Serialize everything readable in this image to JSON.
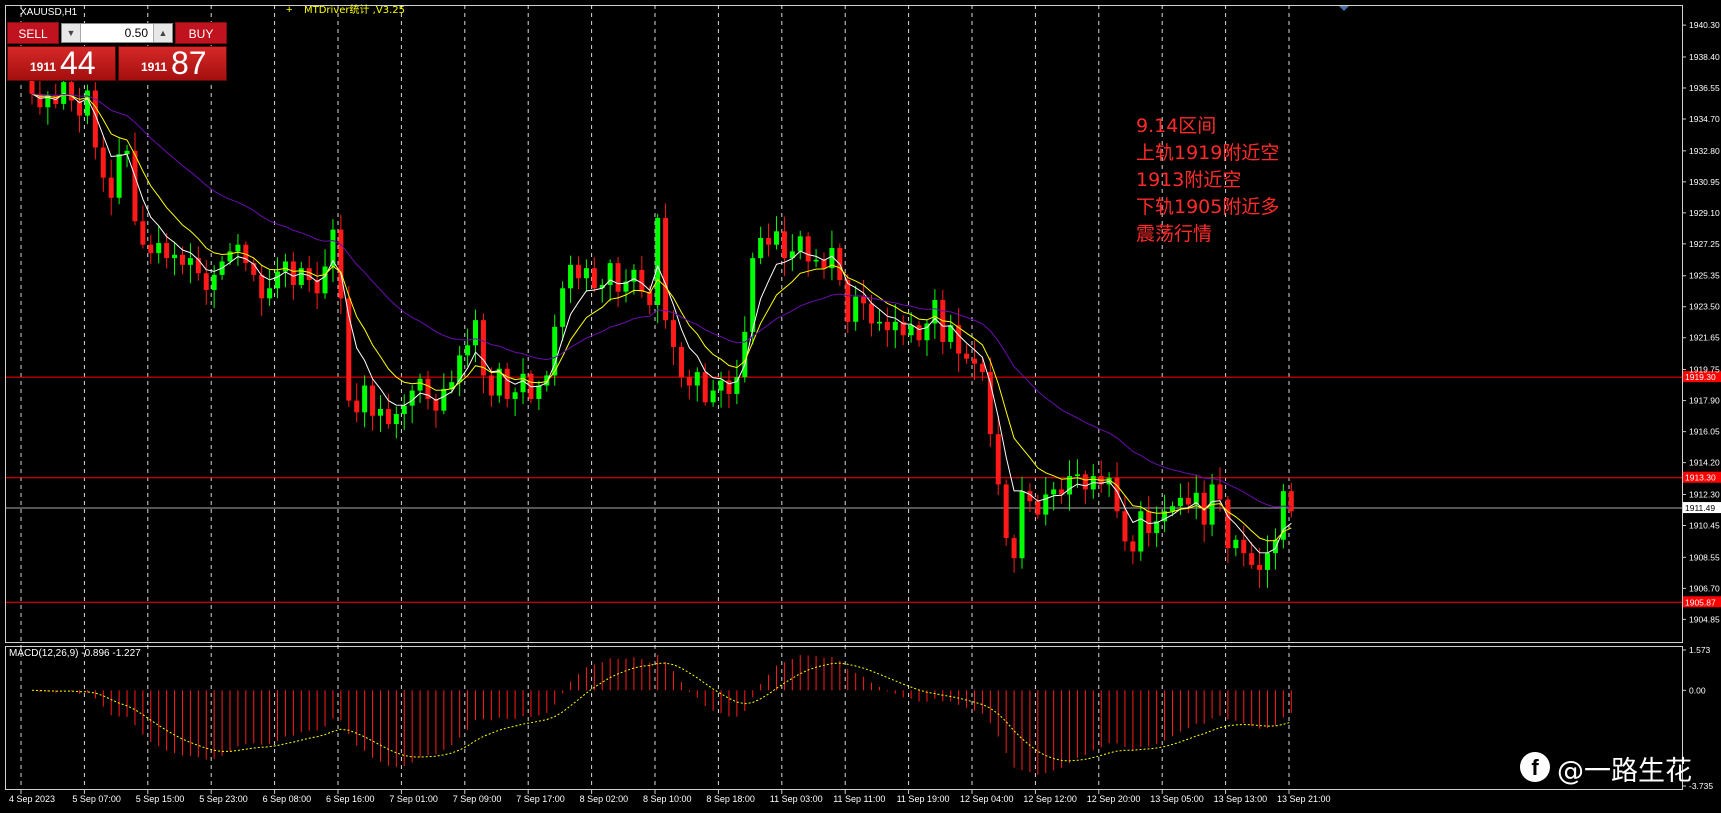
{
  "window": {
    "symbol_label": "XAUUSD,H1",
    "indicator_label": "MTDriver统计 ,V3.25",
    "indicator_plus": "+"
  },
  "trade_panel": {
    "sell_label": "SELL",
    "buy_label": "BUY",
    "lot_value": "0.50",
    "sell_price_small": "1911",
    "sell_price_big": "44",
    "buy_price_small": "1911",
    "buy_price_big": "87"
  },
  "annotation": {
    "lines": [
      "9.14区间",
      "上轨1919附近空",
      "1913附近空",
      "下轨1905附近多",
      "震荡行情"
    ],
    "color": "#ff2a2a"
  },
  "watermark": {
    "icon": "facebook-icon",
    "text": "@一路生花"
  },
  "colors": {
    "bull": "#00ff00",
    "bear": "#ff1a1a",
    "ma_fast": "#ffffff",
    "ma_mid": "#ffff00",
    "ma_slow": "#6a0dad",
    "level": "#ff0000",
    "grid": "#ffffff"
  },
  "chart_data": [
    {
      "type": "candlestick",
      "title": "XAUUSD,H1",
      "ylim": [
        1903.5,
        1941.5
      ],
      "y_ticks": [
        "1940.30",
        "1938.40",
        "1936.55",
        "1934.70",
        "1932.80",
        "1930.95",
        "1929.10",
        "1927.25",
        "1925.35",
        "1923.50",
        "1921.65",
        "1919.75",
        "1917.90",
        "1916.05",
        "1914.20",
        "1912.30",
        "1910.45",
        "1908.55",
        "1906.70",
        "1904.85"
      ],
      "x_labels": [
        "4 Sep 2023",
        "5 Sep 07:00",
        "5 Sep 15:00",
        "5 Sep 23:00",
        "6 Sep 08:00",
        "6 Sep 16:00",
        "7 Sep 01:00",
        "7 Sep 09:00",
        "7 Sep 17:00",
        "8 Sep 02:00",
        "8 Sep 10:00",
        "8 Sep 18:00",
        "11 Sep 03:00",
        "11 Sep 11:00",
        "11 Sep 19:00",
        "12 Sep 04:00",
        "12 Sep 12:00",
        "12 Sep 20:00",
        "13 Sep 05:00",
        "13 Sep 13:00",
        "13 Sep 21:00"
      ],
      "levels": [
        {
          "value": 1919.3,
          "label": "1919.30"
        },
        {
          "value": 1913.3,
          "label": "1913.30"
        },
        {
          "value": 1905.87,
          "label": "1905.87"
        }
      ],
      "current_price": {
        "value": 1911.49,
        "label": "1911.49"
      },
      "closes": [
        1936.2,
        1935.4,
        1936.1,
        1935.6,
        1936.9,
        1935.8,
        1934.9,
        1936.4,
        1933.0,
        1931.2,
        1930.0,
        1932.6,
        1932.8,
        1928.6,
        1927.2,
        1926.7,
        1927.3,
        1926.4,
        1926.6,
        1926.0,
        1926.4,
        1925.5,
        1924.5,
        1925.4,
        1926.2,
        1926.8,
        1927.2,
        1926.1,
        1925.4,
        1924.0,
        1924.6,
        1925.6,
        1926.2,
        1924.8,
        1925.8,
        1925.1,
        1924.3,
        1925.9,
        1928.1,
        1924.0,
        1917.9,
        1917.2,
        1918.8,
        1917.0,
        1917.4,
        1916.5,
        1917.1,
        1917.6,
        1918.5,
        1919.2,
        1918.0,
        1917.3,
        1918.6,
        1919.0,
        1920.6,
        1921.2,
        1922.7,
        1919.4,
        1918.2,
        1919.8,
        1918.0,
        1918.4,
        1919.5,
        1918.0,
        1918.8,
        1919.4,
        1922.3,
        1924.6,
        1926.0,
        1925.2,
        1925.8,
        1924.6,
        1924.8,
        1926.1,
        1924.4,
        1925.0,
        1925.7,
        1924.4,
        1923.6,
        1928.8,
        1922.7,
        1921.1,
        1919.3,
        1918.8,
        1919.6,
        1917.8,
        1918.5,
        1919.1,
        1918.3,
        1919.3,
        1922.0,
        1926.4,
        1927.6,
        1927.2,
        1928.0,
        1926.4,
        1926.8,
        1927.7,
        1926.2,
        1926.3,
        1925.8,
        1927.0,
        1925.1,
        1922.6,
        1924.1,
        1923.7,
        1922.5,
        1922.6,
        1922.1,
        1922.6,
        1921.8,
        1922.4,
        1921.5,
        1922.5,
        1923.9,
        1921.4,
        1922.4,
        1920.7,
        1920.4,
        1920.1,
        1919.6,
        1915.9,
        1912.9,
        1909.7,
        1908.5,
        1912.5,
        1911.9,
        1911.1,
        1912.3,
        1912.6,
        1912.3,
        1913.4,
        1913.5,
        1912.6,
        1913.4,
        1912.9,
        1913.3,
        1911.3,
        1909.5,
        1908.9,
        1911.3,
        1910.0,
        1910.7,
        1911.3,
        1911.6,
        1912.1,
        1911.7,
        1912.4,
        1910.5,
        1912.9,
        1912.0,
        1909.1,
        1909.6,
        1908.8,
        1908.1,
        1907.8,
        1908.8,
        1909.6,
        1912.5,
        1911.3
      ]
    },
    {
      "type": "bar",
      "title": "MACD(12,26,9) -0.896 -1.227",
      "ylim": [
        -3.735,
        1.573
      ],
      "y_ticks": [
        "1.573",
        "0.00",
        "-3.735"
      ]
    }
  ]
}
